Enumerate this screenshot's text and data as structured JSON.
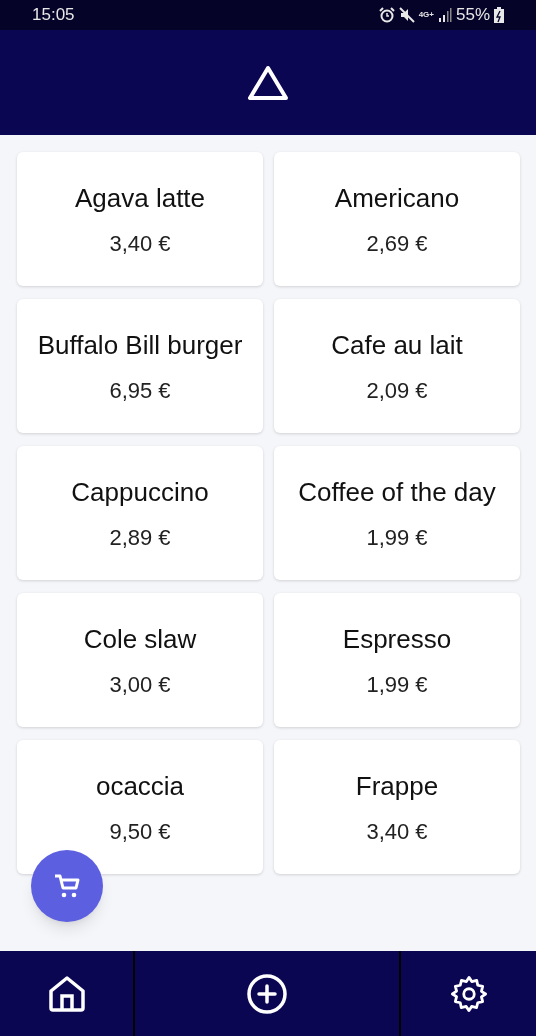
{
  "status_bar": {
    "time": "15:05",
    "network": "4G+",
    "battery": "55%"
  },
  "products": [
    {
      "name": "Agava latte",
      "price": "3,40 €"
    },
    {
      "name": "Americano",
      "price": "2,69 €"
    },
    {
      "name": "Buffalo Bill burger",
      "price": "6,95 €"
    },
    {
      "name": "Cafe au lait",
      "price": "2,09 €"
    },
    {
      "name": "Cappuccino",
      "price": "2,89 €"
    },
    {
      "name": "Coffee of the day",
      "price": "1,99 €"
    },
    {
      "name": "Cole slaw",
      "price": "3,00 €"
    },
    {
      "name": "Espresso",
      "price": "1,99 €"
    },
    {
      "name": "ocaccia",
      "price": "9,50 €"
    },
    {
      "name": "Frappe",
      "price": "3,40 €"
    }
  ],
  "bottom_nav": [
    {
      "kind": "home"
    },
    {
      "kind": "add"
    },
    {
      "kind": "settings"
    }
  ]
}
